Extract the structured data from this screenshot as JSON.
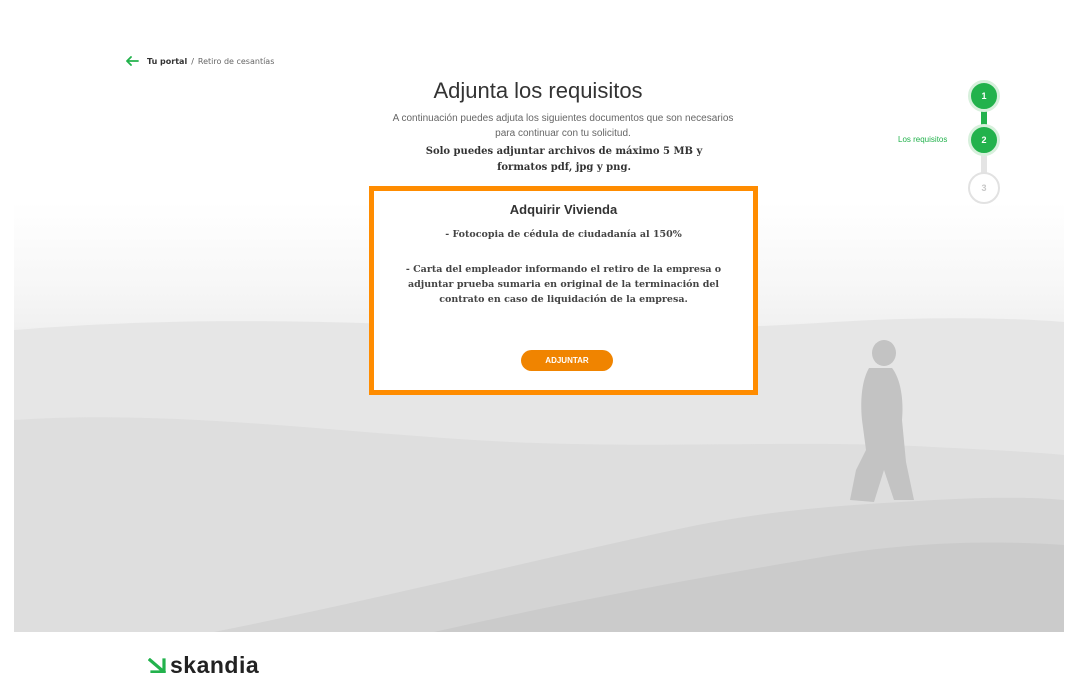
{
  "breadcrumb": {
    "home": "Tu portal",
    "separator": "/",
    "current": "Retiro de cesantías"
  },
  "page": {
    "title": "Adjunta los requisitos",
    "intro": "A continuación puedes adjuta los siguientes documentos que son necesarios para continuar con tu solicitud.",
    "note": "Solo puedes adjuntar archivos de máximo 5 MB y formatos pdf, jpg y png."
  },
  "requirements": {
    "title": "Adquirir Vivienda",
    "items": [
      "- Fotocopia de cédula de ciudadanía al 150%",
      "- Carta del empleador informando el retiro de la empresa o adjuntar prueba sumaria en original de la terminación del contrato en caso de liquidación de la empresa."
    ],
    "button_label": "ADJUNTAR"
  },
  "stepper": {
    "steps": [
      {
        "number": "1",
        "state": "done"
      },
      {
        "number": "2",
        "state": "done"
      },
      {
        "number": "3",
        "state": "pending"
      }
    ],
    "current_label": "Los requisitos"
  },
  "footer": {
    "brand": "skandia"
  },
  "colors": {
    "accent_orange": "#ff8c00",
    "button_orange": "#f08400",
    "step_green": "#22b24c"
  },
  "icons": {
    "back": "arrow-left-icon",
    "logo": "skandia-logo-mark"
  }
}
